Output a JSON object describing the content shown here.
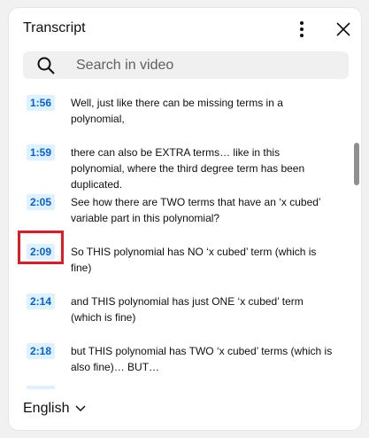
{
  "header": {
    "title": "Transcript"
  },
  "search": {
    "placeholder": "Search in video"
  },
  "segments": [
    {
      "time": "1:56",
      "text": "Well, just like there can be missing terms in a polynomial,"
    },
    {
      "time": "1:59",
      "text": "there can also be EXTRA terms… like in this polynomial, where the third degree term has been duplicated."
    },
    {
      "time": "2:05",
      "text": "See how there are TWO terms that have an ‘x cubed’ variable part in this polynomial?"
    },
    {
      "time": "2:09",
      "text": "So THIS polynomial has NO ‘x cubed’ term (which is fine)"
    },
    {
      "time": "2:14",
      "text": "and THIS polynomial has just ONE ‘x cubed’ term (which is fine)"
    },
    {
      "time": "2:18",
      "text": "but THIS polynomial has TWO ‘x cubed’ terms (which is also fine)… BUT…"
    }
  ],
  "footer": {
    "language": "English"
  },
  "colors": {
    "timestamp_bg": "#def1ff",
    "timestamp_text": "#065fd4",
    "highlight": "#e01b24"
  }
}
